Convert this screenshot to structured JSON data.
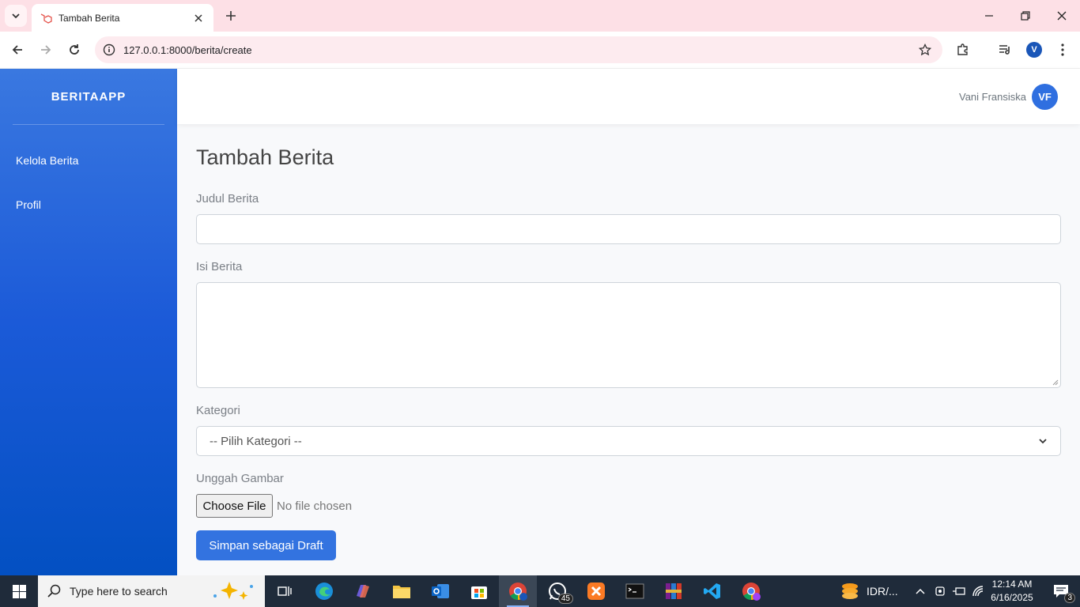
{
  "browser": {
    "tab_title": "Tambah Berita",
    "url": "127.0.0.1:8000/berita/create",
    "profile_initial": "V"
  },
  "sidebar": {
    "brand": "BERITAAPP",
    "items": [
      {
        "label": "Kelola Berita"
      },
      {
        "label": "Profil"
      }
    ]
  },
  "header": {
    "username": "Vani Fransiska",
    "avatar_initials": "VF"
  },
  "form": {
    "title": "Tambah Berita",
    "judul_label": "Judul Berita",
    "judul_value": "",
    "isi_label": "Isi Berita",
    "isi_value": "",
    "kategori_label": "Kategori",
    "kategori_selected": "-- Pilih Kategori --",
    "gambar_label": "Unggah Gambar",
    "file_button": "Choose File",
    "file_status": "No file chosen",
    "submit_label": "Simpan sebagai Draft"
  },
  "taskbar": {
    "search_placeholder": "Type here to search",
    "whatsapp_badge": "45",
    "currency": "IDR/...",
    "time": "12:14 AM",
    "date": "6/16/2025",
    "notifications": "3"
  },
  "colors": {
    "sidebar_top": "#3a78e0",
    "sidebar_bottom": "#0350c2",
    "primary_button": "#3373e0",
    "titlebar": "#fde0e6"
  }
}
